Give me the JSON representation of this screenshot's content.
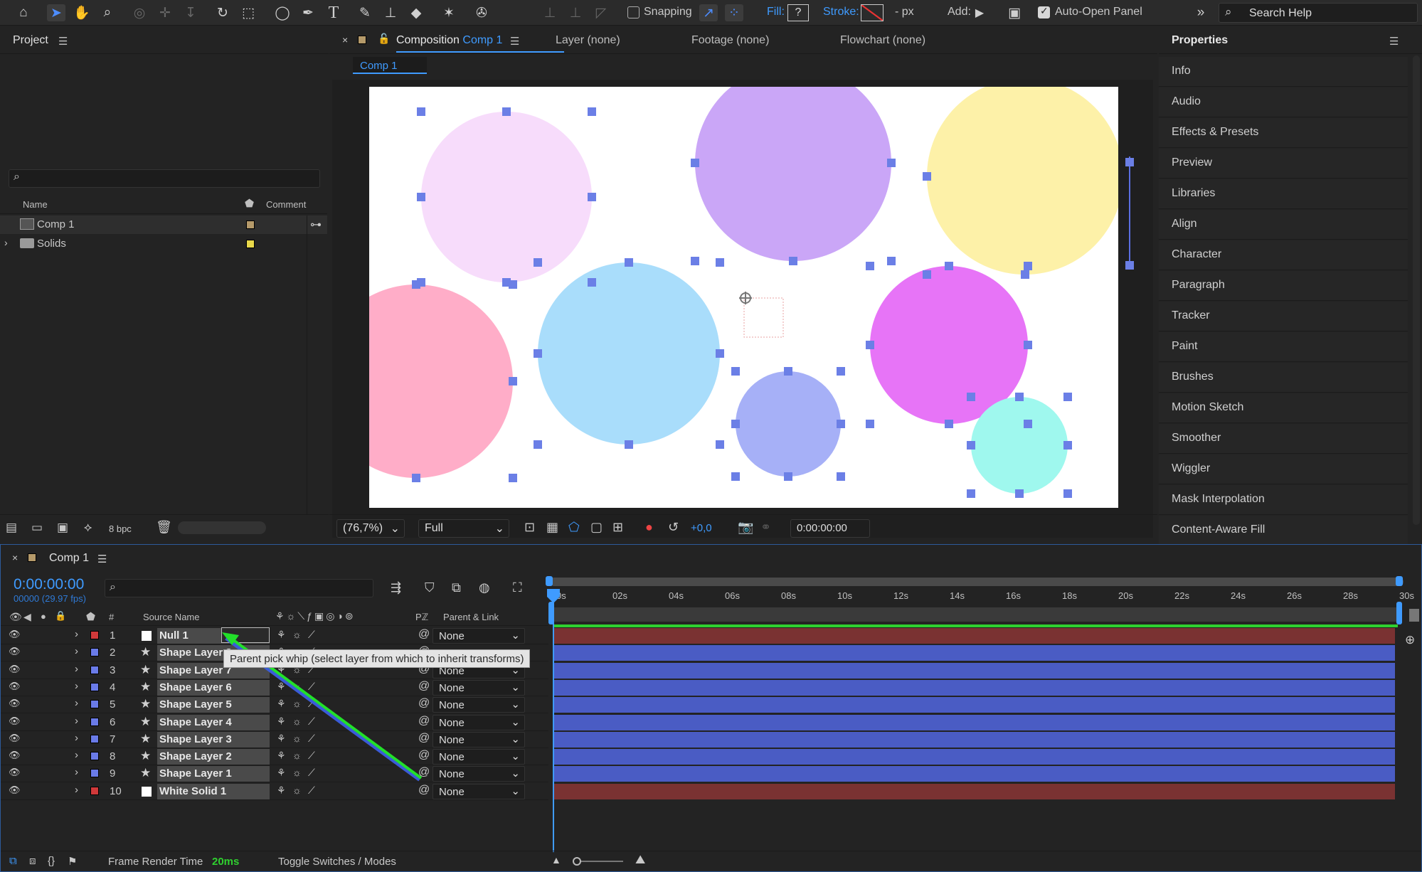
{
  "toolbar": {
    "snapping_label": "Snapping",
    "fill_label": "Fill:",
    "fill_value": "?",
    "stroke_label": "Stroke:",
    "stroke_unit": "- px",
    "add_label": "Add:",
    "auto_open_label": "Auto-Open Panel",
    "search_placeholder": "Search Help",
    "icons": [
      "home-icon",
      "selection-tool-icon",
      "hand-tool-icon",
      "zoom-tool-icon",
      "orbit-icon",
      "pan-icon",
      "dolly-icon",
      "rotate-icon",
      "pan-behind-icon",
      "ellipse-tool-icon",
      "pen-tool-icon",
      "type-tool-icon",
      "brush-icon",
      "clone-stamp-icon",
      "eraser-icon",
      "roto-brush-icon",
      "puppet-icon"
    ]
  },
  "project": {
    "title": "Project",
    "columns": {
      "name": "Name",
      "comment": "Comment"
    },
    "items": [
      {
        "name": "Comp 1",
        "color": "#b59a6a",
        "type": "comp"
      },
      {
        "name": "Solids",
        "color": "#e8d84a",
        "type": "folder"
      }
    ],
    "bpc": "8 bpc"
  },
  "composition": {
    "tab_prefix": "Composition",
    "tab_name": "Comp 1",
    "layer_tab": "Layer (none)",
    "footage_tab": "Footage (none)",
    "flowchart_tab": "Flowchart (none)",
    "breadcrumb": "Comp 1",
    "zoom": "(76,7%)",
    "resolution": "Full",
    "exposure": "+0,0",
    "timecode": "0:00:00:00"
  },
  "circles": [
    {
      "color": "#f7dcfb"
    },
    {
      "color": "#caa6f7"
    },
    {
      "color": "#fdf1a8"
    },
    {
      "color": "#ffadc8"
    },
    {
      "color": "#a9ddfb"
    },
    {
      "color": "#e774f7"
    },
    {
      "color": "#a6b0f7"
    },
    {
      "color": "#9ff8ee"
    }
  ],
  "properties": {
    "title": "Properties",
    "items": [
      "Info",
      "Audio",
      "Effects & Presets",
      "Preview",
      "Libraries",
      "Align",
      "Character",
      "Paragraph",
      "Tracker",
      "Paint",
      "Brushes",
      "Motion Sketch",
      "Smoother",
      "Wiggler",
      "Mask Interpolation",
      "Content-Aware Fill"
    ]
  },
  "timeline": {
    "comp_tab": "Comp 1",
    "timecode": "0:00:00:00",
    "frames": "00000 (29.97 fps)",
    "headers": {
      "hash": "#",
      "source_name": "Source Name",
      "parent_link": "Parent & Link",
      "pz": "Pℤ"
    },
    "ruler": [
      "0s",
      "02s",
      "04s",
      "06s",
      "08s",
      "10s",
      "12s",
      "14s",
      "16s",
      "18s",
      "20s",
      "22s",
      "24s",
      "26s",
      "28s",
      "30s"
    ],
    "layers": [
      {
        "num": "1",
        "name": "Null 1",
        "label": "#d0393a",
        "kind": "solid",
        "parent": ""
      },
      {
        "num": "2",
        "name": "Shape Layer 8",
        "label": "#6a7be8",
        "kind": "shape",
        "parent": ""
      },
      {
        "num": "3",
        "name": "Shape Layer 7",
        "label": "#6a7be8",
        "kind": "shape",
        "parent": "None"
      },
      {
        "num": "4",
        "name": "Shape Layer 6",
        "label": "#6a7be8",
        "kind": "shape",
        "parent": "None"
      },
      {
        "num": "5",
        "name": "Shape Layer 5",
        "label": "#6a7be8",
        "kind": "shape",
        "parent": "None"
      },
      {
        "num": "6",
        "name": "Shape Layer 4",
        "label": "#6a7be8",
        "kind": "shape",
        "parent": "None"
      },
      {
        "num": "7",
        "name": "Shape Layer 3",
        "label": "#6a7be8",
        "kind": "shape",
        "parent": "None"
      },
      {
        "num": "8",
        "name": "Shape Layer 2",
        "label": "#6a7be8",
        "kind": "shape",
        "parent": "None"
      },
      {
        "num": "9",
        "name": "Shape Layer 1",
        "label": "#6a7be8",
        "kind": "shape",
        "parent": "None"
      },
      {
        "num": "10",
        "name": "White Solid 1",
        "label": "#d0393a",
        "kind": "solid",
        "parent": "None"
      }
    ],
    "null_parent": "None",
    "tooltip": "Parent pick whip (select layer from which to inherit transforms)",
    "footer": {
      "render_label": "Frame Render Time",
      "render_value": "20ms",
      "toggle": "Toggle Switches / Modes"
    }
  }
}
